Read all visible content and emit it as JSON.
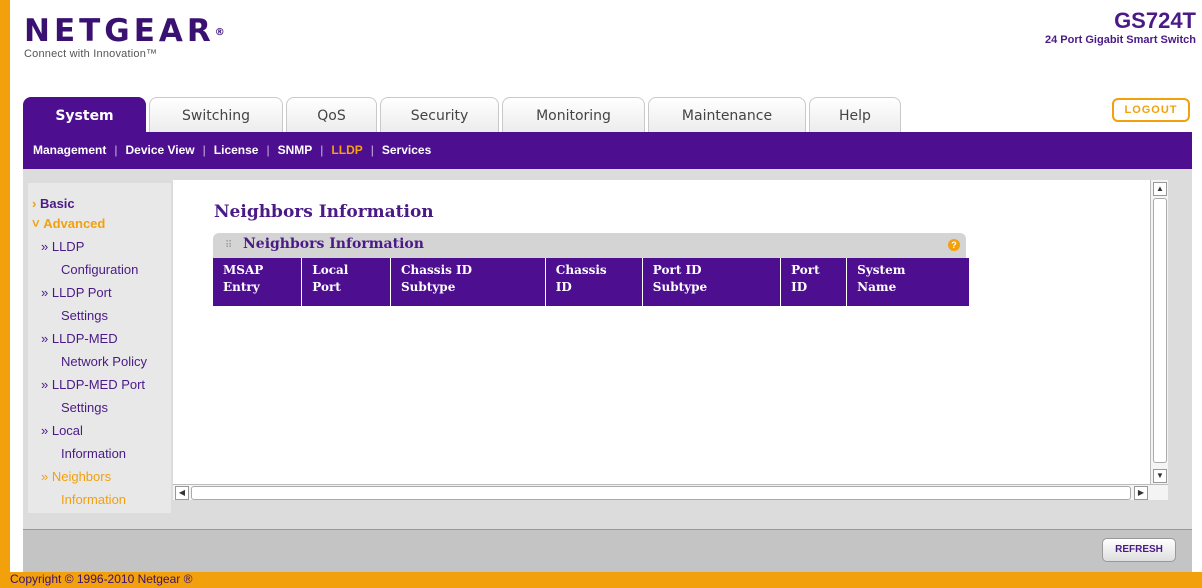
{
  "header": {
    "logo": "NETGEAR",
    "logo_mark": "®",
    "tagline": "Connect with Innovation™",
    "model": "GS724T",
    "model_desc": "24 Port Gigabit Smart Switch",
    "logout": "LOGOUT"
  },
  "tabs": [
    {
      "label": "System",
      "active": true
    },
    {
      "label": "Switching"
    },
    {
      "label": "QoS"
    },
    {
      "label": "Security"
    },
    {
      "label": "Monitoring"
    },
    {
      "label": "Maintenance"
    },
    {
      "label": "Help"
    }
  ],
  "subnav": [
    {
      "label": "Management"
    },
    {
      "label": "Device View"
    },
    {
      "label": "License"
    },
    {
      "label": "SNMP"
    },
    {
      "label": "LLDP",
      "active": true
    },
    {
      "label": "Services"
    }
  ],
  "sidebar": {
    "basic": "Basic",
    "advanced": "Advanced",
    "items": [
      {
        "label": "» LLDP",
        "cont": "Configuration"
      },
      {
        "label": "» LLDP Port",
        "cont": "Settings"
      },
      {
        "label": "» LLDP-MED",
        "cont": "Network Policy"
      },
      {
        "label": "» LLDP-MED Port",
        "cont": "Settings"
      },
      {
        "label": "» Local",
        "cont": "Information"
      },
      {
        "label": "» Neighbors",
        "cont": "Information",
        "active": true
      }
    ]
  },
  "main": {
    "page_title": "Neighbors Information",
    "table_title": "Neighbors Information",
    "help_icon": "?",
    "columns": [
      {
        "line1": "MSAP",
        "line2": "Entry"
      },
      {
        "line1": "Local",
        "line2": "Port"
      },
      {
        "line1": "Chassis ID",
        "line2": "Subtype"
      },
      {
        "line1": "Chassis",
        "line2": "ID"
      },
      {
        "line1": "Port ID",
        "line2": "Subtype"
      },
      {
        "line1": "Port",
        "line2": "ID"
      },
      {
        "line1": "System",
        "line2": "Name"
      }
    ]
  },
  "buttons": {
    "refresh": "REFRESH"
  },
  "footer": {
    "copyright": "Copyright © 1996-2010 Netgear ®"
  },
  "colors": {
    "brand_purple": "#4d0f8f",
    "accent_orange": "#f2a10c"
  }
}
